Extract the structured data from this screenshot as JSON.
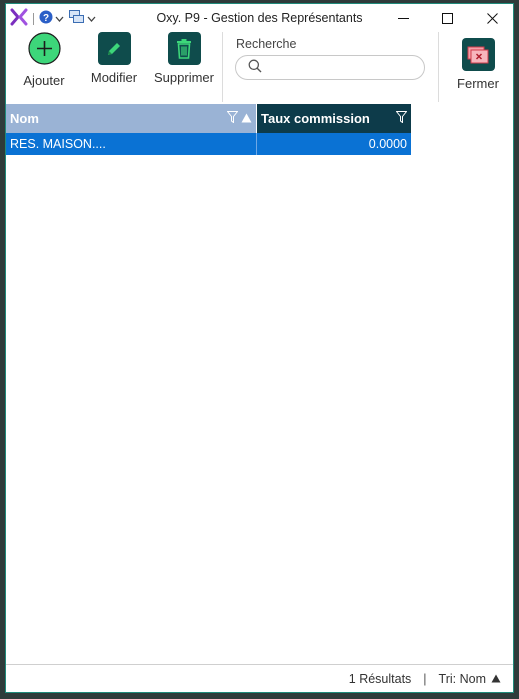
{
  "window": {
    "title": "Oxy. P9 - Gestion des Représentants"
  },
  "toolbar": {
    "add_label": "Ajouter",
    "edit_label": "Modifier",
    "delete_label": "Supprimer",
    "close_label": "Fermer"
  },
  "search": {
    "label": "Recherche",
    "value": ""
  },
  "grid": {
    "columns": [
      "Nom",
      "Taux commission"
    ],
    "rows": [
      {
        "nom": "RES. MAISON....",
        "taux": "0.0000"
      }
    ]
  },
  "status": {
    "results": "1 Résultats",
    "sort": "Tri: Nom"
  },
  "colors": {
    "accent_teal": "#0f4c4c",
    "add_green": "#3dd67a",
    "header_nom": "#9ab3d5",
    "header_taux": "#0d3b4a",
    "selection": "#0a72d4"
  }
}
